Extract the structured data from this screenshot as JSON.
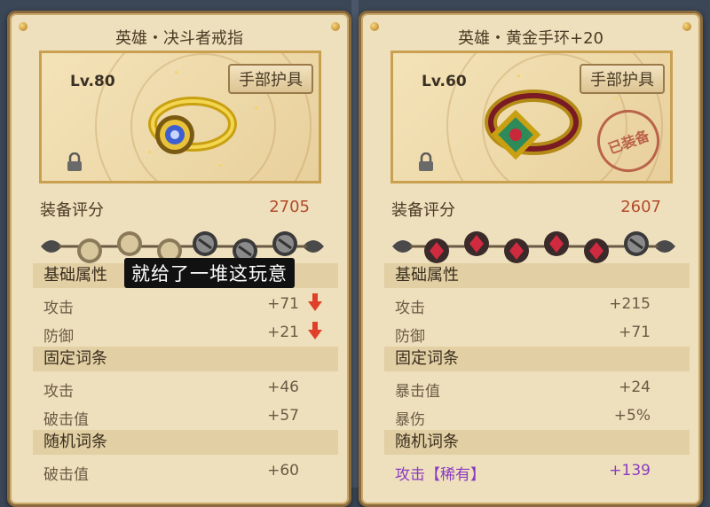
{
  "caption": "就给了一堆这玩意",
  "left": {
    "title": "英雄・决斗者戒指",
    "level": "Lv.80",
    "slot": "手部护具",
    "score_label": "装备评分",
    "score": "2705",
    "base_section": "基础属性",
    "base": [
      {
        "name": "攻击",
        "value": "+71"
      },
      {
        "name": "防御",
        "value": "+21"
      }
    ],
    "fixed_section": "固定词条",
    "fixed": [
      {
        "name": "攻击",
        "value": "+46"
      },
      {
        "name": "破击值",
        "value": "+57"
      }
    ],
    "random_section": "随机词条",
    "random": [
      {
        "name": "破击值",
        "value": "+60"
      }
    ]
  },
  "right": {
    "title": "英雄・黄金手环+20",
    "level": "Lv.60",
    "slot": "手部护具",
    "stamp": "已装备",
    "score_label": "装备评分",
    "score": "2607",
    "base_section": "基础属性",
    "base": [
      {
        "name": "攻击",
        "value": "+215"
      },
      {
        "name": "防御",
        "value": "+71"
      }
    ],
    "fixed_section": "固定词条",
    "fixed": [
      {
        "name": "暴击值",
        "value": "+24"
      },
      {
        "name": "暴伤",
        "value": "+5%"
      }
    ],
    "random_section": "随机词条",
    "random": [
      {
        "name": "攻击【稀有】",
        "value": "+139"
      }
    ]
  },
  "colors": {
    "score": "#b24b2a",
    "rare": "#8a3ac0",
    "down_arrow": "#e0402a"
  }
}
